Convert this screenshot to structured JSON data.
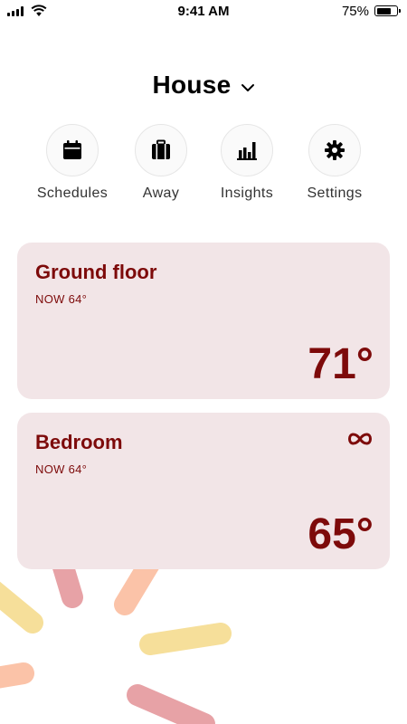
{
  "status_bar": {
    "time": "9:41 AM",
    "battery_percent_label": "75%",
    "battery_level": 0.75
  },
  "home": {
    "title": "House"
  },
  "actions": [
    {
      "label": "Schedules",
      "icon": "calendar-icon"
    },
    {
      "label": "Away",
      "icon": "suitcase-icon"
    },
    {
      "label": "Insights",
      "icon": "bar-chart-icon"
    },
    {
      "label": "Settings",
      "icon": "gear-icon"
    }
  ],
  "zones": [
    {
      "name": "Ground floor",
      "current": "NOW 64°",
      "target": "71°",
      "mode_icon": ""
    },
    {
      "name": "Bedroom",
      "current": "NOW 64°",
      "target": "65°",
      "mode_icon": "infinity-icon"
    }
  ],
  "colors": {
    "card_background": "#f2e5e7",
    "card_text": "#7d0a0a",
    "streak_pink": "#e7a2a6",
    "streak_yellow": "#f6df9a",
    "streak_orange": "#fbc3a8"
  }
}
